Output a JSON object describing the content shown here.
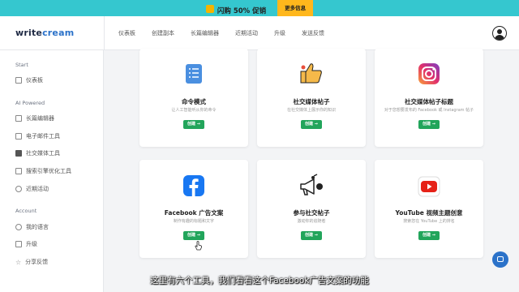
{
  "promo": {
    "text": "闪购 50% 促销",
    "button": "更多信息",
    "color": "#35c7cf",
    "button_color": "#ffb71c"
  },
  "logo": {
    "part1": "write",
    "part2": "cream"
  },
  "nav": {
    "items": [
      "仪表板",
      "创建副本",
      "长篇编辑器",
      "近期活动",
      "升级",
      "发送反馈"
    ]
  },
  "sidebar": {
    "sections": [
      "Start",
      "AI Powered",
      "Account"
    ],
    "items": [
      "仪表板",
      "长篇编辑器",
      "电子邮件工具",
      "社交媒体工具",
      "搜索引擎优化工具",
      "近期活动",
      "我的语言",
      "升级",
      "分享反馈"
    ]
  },
  "cards": [
    {
      "title": "命令模式",
      "desc": "让人工智能听从你的命令",
      "button": "创建 →",
      "icon": "command-list-icon"
    },
    {
      "title": "社交媒体帖子",
      "desc": "在社交媒体上展示你的知识",
      "button": "创建 →",
      "icon": "thumbs-up-icon"
    },
    {
      "title": "社交媒体帖子标题",
      "desc": "对于您想要发布的 Facebook 或 Instagram 帖子",
      "button": "创建 →",
      "icon": "instagram-icon"
    },
    {
      "title": "Facebook 广告文案",
      "desc": "制作有趣的标题和文字",
      "button": "创建 →",
      "icon": "facebook-icon"
    },
    {
      "title": "参与社交帖子",
      "desc": "激动你的追随者",
      "button": "创建 →",
      "icon": "megaphone-icon"
    },
    {
      "title": "YouTube 视频主题创意",
      "desc": "搜索您在 YouTube 上的排名",
      "button": "创建 →",
      "icon": "youtube-icon"
    }
  ],
  "subtitle": "这里有六个工具，我们看看这个Facebook广告文案的功能",
  "colors": {
    "accent": "#22a55b",
    "brand_blue": "#2b72c9",
    "facebook": "#1877f2",
    "youtube": "#e62117"
  }
}
